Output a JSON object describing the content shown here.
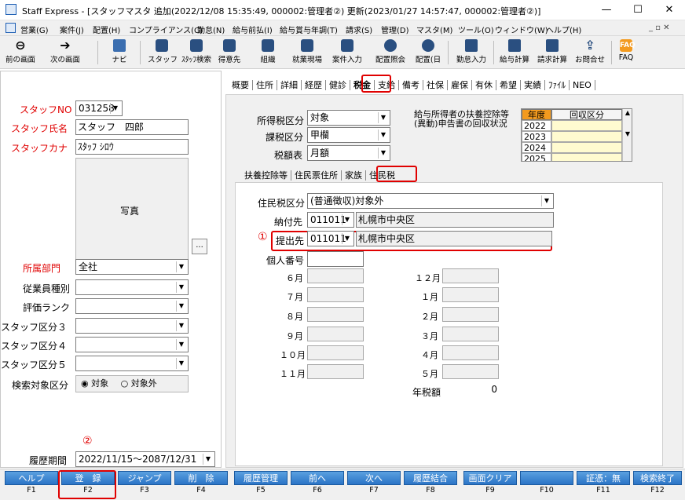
{
  "window": {
    "title": "Staff Express - [スタッフマスタ 追加(2022/12/08 15:35:49, 000002:管理者②) 更新(2023/01/27 14:57:47, 000002:管理者②)]",
    "minimize": "—",
    "maximize": "☐",
    "close": "✕"
  },
  "menu": [
    "営業(G)",
    "案件(J)",
    "配置(H)",
    "コンプライアンス(C)",
    "勤怠(N)",
    "給与前払(I)",
    "給与賞与年調(T)",
    "請求(S)",
    "管理(D)",
    "マスタ(M)",
    "ツール(O)",
    "ウィンドウ(W)",
    "ヘルプ(H)"
  ],
  "toolbar": [
    "前の画面",
    "次の画面",
    "ナビ",
    "スタッフ",
    "ｽﾀｯﾌ検索",
    "得意先",
    "組織",
    "就業現場",
    "案件入力",
    "配置照会",
    "配置(日",
    "勤怠入力",
    "給与計算",
    "請求計算",
    "お問合せ",
    "FAQ"
  ],
  "left": {
    "staff_no_label": "スタッフNO",
    "staff_no": "031258",
    "name_label": "スタッフ氏名",
    "name": "スタッフ　四郎",
    "kana_label": "スタッフカナ",
    "kana": "ｽﾀｯﾌ ｼﾛｳ",
    "photo_label": "写真",
    "photo_btn": "...",
    "dept_label": "所属部門",
    "dept": "全社",
    "emp_type_label": "従業員種別",
    "rank_label": "評価ランク",
    "kubun3_label": "スタッフ区分３",
    "kubun4_label": "スタッフ区分４",
    "kubun5_label": "スタッフ区分５",
    "search_label": "検索対象区分",
    "search_opt1": "対象",
    "search_opt2": "対象外",
    "period_label": "履歴期間",
    "period": "2022/11/15～2087/12/31"
  },
  "tabs": [
    "概要",
    "住所",
    "詳細",
    "経歴",
    "健診",
    "税金",
    "支給",
    "備考",
    "社保",
    "雇保",
    "有休",
    "希望",
    "実績",
    "ﾌｧｲﾙ",
    "NEO"
  ],
  "tax": {
    "income_tax_label": "所得税区分",
    "income_tax": "対象",
    "tax_class_label": "課税区分",
    "tax_class": "甲欄",
    "tax_table_label": "税額表",
    "tax_table": "月額",
    "deduction_note": "給与所得者の扶養控除等(異動)申告書の回収状況",
    "grid_headers": [
      "年度",
      "回収区分"
    ],
    "grid_years": [
      "2022",
      "2023",
      "2024",
      "2025"
    ]
  },
  "subtabs": [
    "扶養控除等",
    "住民票住所",
    "家族",
    "住民税"
  ],
  "resident": {
    "kubun_label": "住民税区分",
    "kubun": "(普通徴収)対象外",
    "payee_label": "納付先",
    "payee_code": "011011",
    "payee_name": "札幌市中央区",
    "submit_label": "提出先",
    "submit_code": "011011",
    "submit_name": "札幌市中央区",
    "mynumber_label": "個人番号",
    "months_left": [
      "６月",
      "７月",
      "８月",
      "９月",
      "１０月",
      "１１月"
    ],
    "months_right": [
      "１２月",
      "１月",
      "２月",
      "３月",
      "４月",
      "５月"
    ],
    "annual_label": "年税額",
    "annual_value": "0"
  },
  "markers": {
    "one": "①",
    "two": "②"
  },
  "fkeys": [
    {
      "label": "ヘルプ",
      "key": "F1"
    },
    {
      "label": "登　録",
      "key": "F2"
    },
    {
      "label": "ジャンプ",
      "key": "F3"
    },
    {
      "label": "削　除",
      "key": "F4"
    },
    {
      "label": "履歴管理",
      "key": "F5"
    },
    {
      "label": "前へ",
      "key": "F6"
    },
    {
      "label": "次へ",
      "key": "F7"
    },
    {
      "label": "履歴結合",
      "key": "F8"
    },
    {
      "label": "画面クリア",
      "key": "F9"
    },
    {
      "label": "",
      "key": "F10"
    },
    {
      "label": "証憑：無",
      "key": "F11"
    },
    {
      "label": "検索終了",
      "key": "F12"
    }
  ]
}
